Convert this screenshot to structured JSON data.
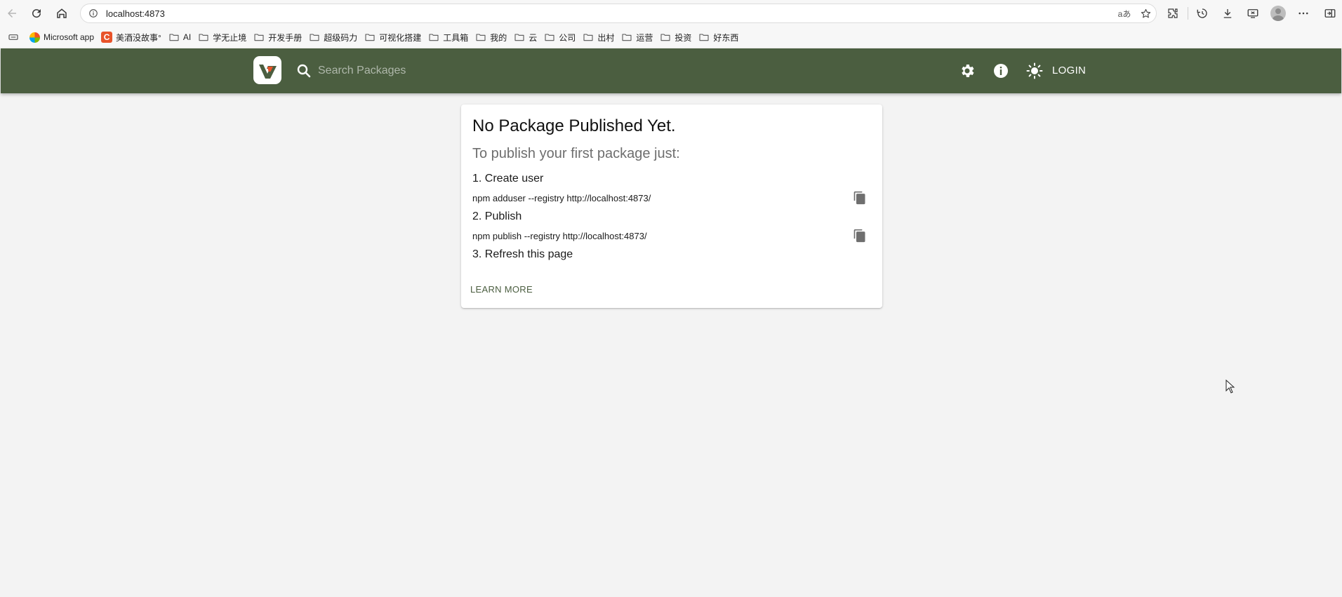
{
  "browser": {
    "url": "localhost:4873",
    "read_aloud_label": "aあ",
    "bookmarks": [
      {
        "label": "Microsoft app",
        "icon": "microsoft-logo"
      },
      {
        "label": "美酒没故事°",
        "icon": "c-logo",
        "badge": "C"
      },
      {
        "label": "AI",
        "icon": "folder-icon"
      },
      {
        "label": "学无止境",
        "icon": "folder-icon"
      },
      {
        "label": "开发手册",
        "icon": "folder-icon"
      },
      {
        "label": "超级码力",
        "icon": "folder-icon"
      },
      {
        "label": "可视化搭建",
        "icon": "folder-icon"
      },
      {
        "label": "工具箱",
        "icon": "folder-icon"
      },
      {
        "label": "我的",
        "icon": "folder-icon"
      },
      {
        "label": "云",
        "icon": "folder-icon"
      },
      {
        "label": "公司",
        "icon": "folder-icon"
      },
      {
        "label": "出村",
        "icon": "folder-icon"
      },
      {
        "label": "运营",
        "icon": "folder-icon"
      },
      {
        "label": "投资",
        "icon": "folder-icon"
      },
      {
        "label": "好东西",
        "icon": "folder-icon"
      }
    ]
  },
  "header": {
    "search_placeholder": "Search Packages",
    "login_label": "LOGIN",
    "icons": [
      "settings-icon",
      "info-icon",
      "theme-toggle-icon"
    ],
    "background_color": "#4b5e40"
  },
  "card": {
    "title": "No Package Published Yet.",
    "subtitle": "To publish your first package just:",
    "step1": "1. Create user",
    "cmd1": "npm adduser --registry http://localhost:4873/",
    "step2": "2. Publish",
    "cmd2": "npm publish --registry http://localhost:4873/",
    "step3": "3. Refresh this page",
    "learn_more": "LEARN MORE"
  }
}
